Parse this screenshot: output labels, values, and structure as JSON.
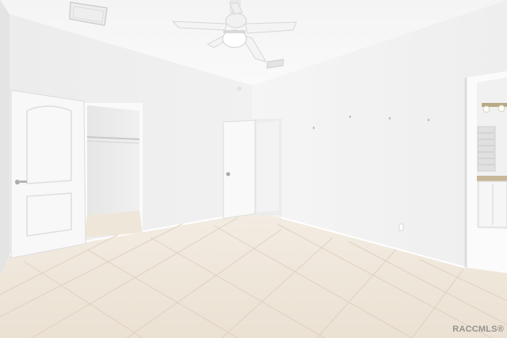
{
  "image": {
    "subject": "empty-bedroom-interior",
    "watermark": "RACCMLS®"
  },
  "colors": {
    "wall": "#f3f3f3",
    "ceiling": "#f7f7f7",
    "floor_tile": "#efe6da",
    "grout": "#d9cdbd",
    "door": "#f8f8f8",
    "accent_vanity": "#c9b79a"
  }
}
